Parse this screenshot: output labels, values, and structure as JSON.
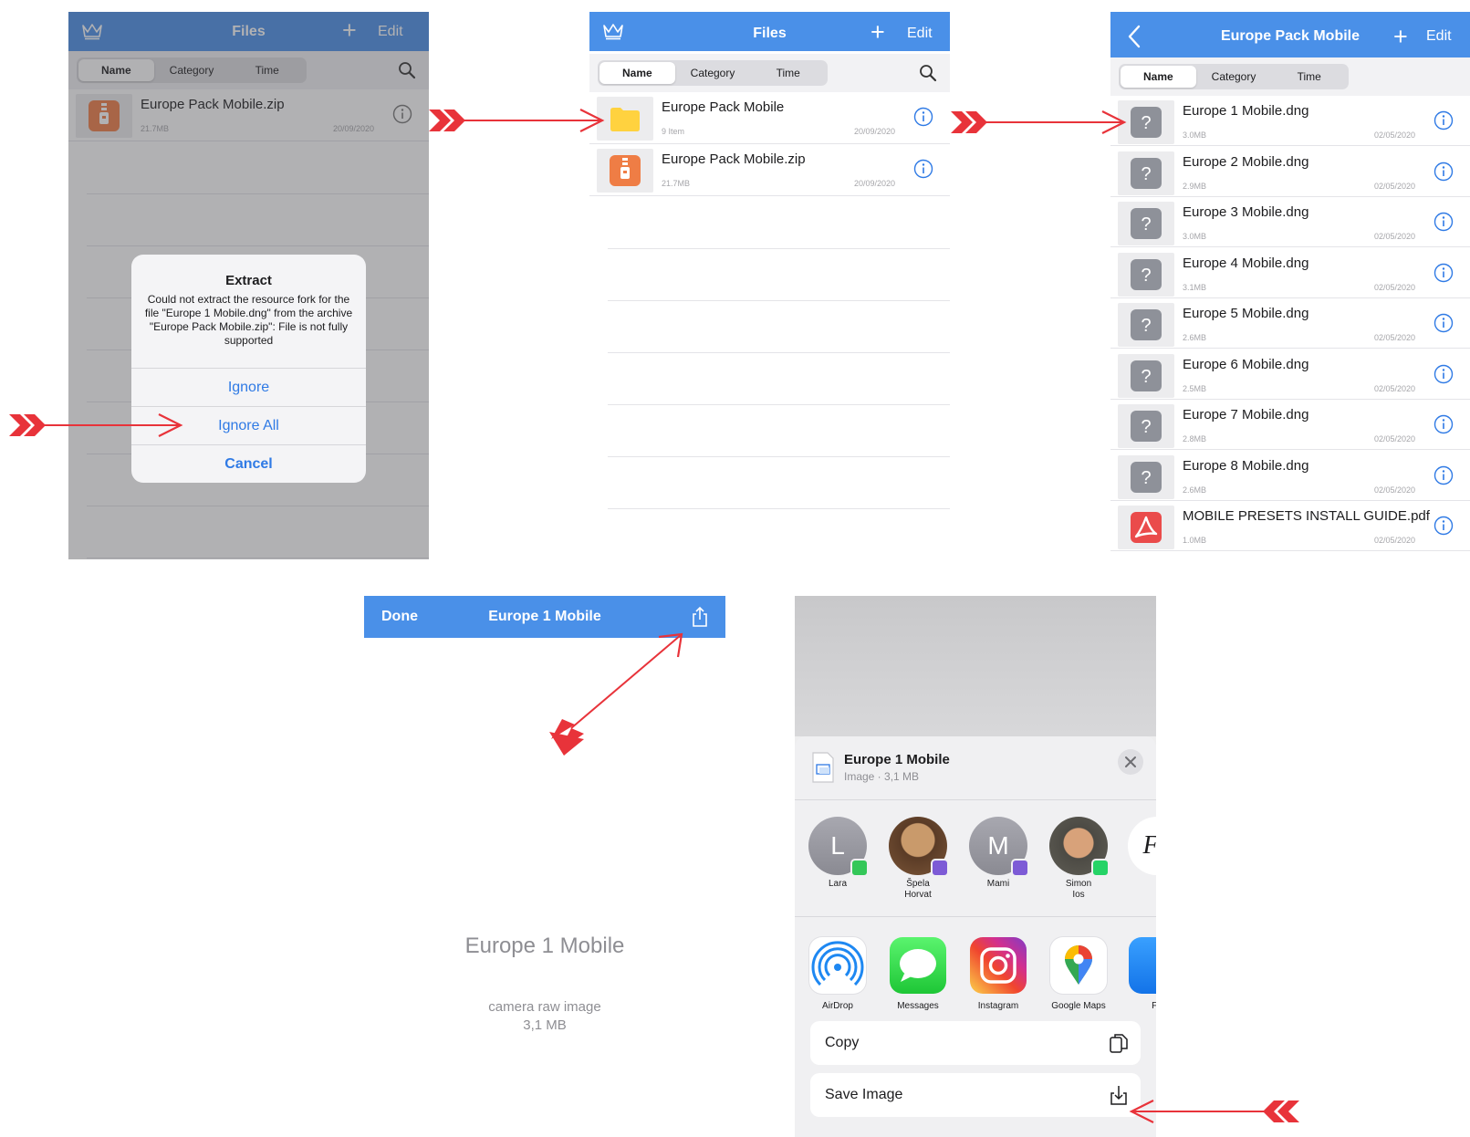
{
  "files_screen": {
    "title": "Files",
    "edit_label": "Edit",
    "plus_label": "+",
    "sort": [
      "Name",
      "Category",
      "Time"
    ],
    "zip_item": {
      "name": "Europe Pack Mobile.zip",
      "size": "21.7MB",
      "date": "20/09/2020"
    },
    "folder_item": {
      "name": "Europe Pack Mobile",
      "count": "9 Item",
      "date": "20/09/2020"
    }
  },
  "extract_alert": {
    "title": "Extract",
    "message": "Could not extract the resource fork for the file \"Europe 1 Mobile.dng\" from the archive \"Europe Pack Mobile.zip\": File is not fully supported",
    "ignore": "Ignore",
    "ignore_all": "Ignore All",
    "cancel": "Cancel"
  },
  "folder_screen": {
    "title": "Europe Pack Mobile",
    "edit_label": "Edit",
    "plus_label": "+",
    "sort": [
      "Name",
      "Category",
      "Time"
    ],
    "items": [
      {
        "name": "Europe 1 Mobile.dng",
        "size": "3.0MB",
        "date": "02/05/2020"
      },
      {
        "name": "Europe 2 Mobile.dng",
        "size": "2.9MB",
        "date": "02/05/2020"
      },
      {
        "name": "Europe 3 Mobile.dng",
        "size": "3.0MB",
        "date": "02/05/2020"
      },
      {
        "name": "Europe 4 Mobile.dng",
        "size": "3.1MB",
        "date": "02/05/2020"
      },
      {
        "name": "Europe 5 Mobile.dng",
        "size": "2.6MB",
        "date": "02/05/2020"
      },
      {
        "name": "Europe 6 Mobile.dng",
        "size": "2.5MB",
        "date": "02/05/2020"
      },
      {
        "name": "Europe 7 Mobile.dng",
        "size": "2.8MB",
        "date": "02/05/2020"
      },
      {
        "name": "Europe 8 Mobile.dng",
        "size": "2.6MB",
        "date": "02/05/2020"
      },
      {
        "name": "MOBILE PRESETS INSTALL GUIDE.pdf",
        "size": "1.0MB",
        "date": "02/05/2020"
      }
    ]
  },
  "preview": {
    "done_label": "Done",
    "title": "Europe 1 Mobile",
    "file_name": "Europe 1 Mobile",
    "file_type": "camera raw image",
    "file_size": "3,1 MB"
  },
  "share_sheet": {
    "title": "Europe 1 Mobile",
    "subtitle": "Image · 3,1 MB",
    "people": [
      {
        "name": "Lara",
        "initial": "L",
        "badge_color": "#34c759"
      },
      {
        "name": "Špela\nHorvat",
        "initial": "",
        "badge_color": "#7d5bd6"
      },
      {
        "name": "Mami",
        "initial": "M",
        "badge_color": "#7d5bd6"
      },
      {
        "name": "Simon\nIos",
        "initial": "",
        "badge_color": "#25d366"
      },
      {
        "name": "(",
        "initial": "Fa",
        "badge_color": ""
      }
    ],
    "apps": [
      {
        "name": "AirDrop",
        "icon": "airdrop-icon"
      },
      {
        "name": "Messages",
        "icon": "messages-icon"
      },
      {
        "name": "Instagram",
        "icon": "instagram-icon"
      },
      {
        "name": "Google Maps",
        "icon": "google-maps-icon"
      },
      {
        "name": "Fa",
        "icon": "files-app-icon"
      }
    ],
    "actions": [
      {
        "label": "Copy",
        "icon": "copy-icon"
      },
      {
        "label": "Save Image",
        "icon": "save-image-icon"
      }
    ]
  },
  "colors": {
    "nav_blue": "#4a90e8",
    "link_blue": "#2f7ae5",
    "arrow_red": "#e8333a",
    "zip_orange": "#ef7d45",
    "folder_yellow": "#ffd23f",
    "unknown_gray": "#8e9199",
    "pdf_red": "#ea4b4b"
  }
}
